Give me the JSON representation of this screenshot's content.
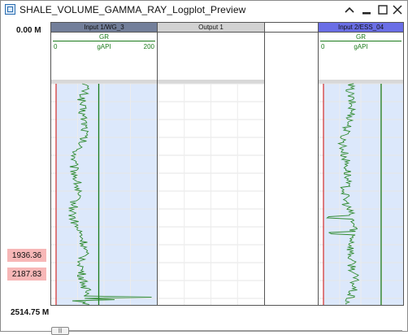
{
  "window": {
    "title": "SHALE_VOLUME_GAMMA_RAY_Logplot_Preview",
    "controls": {
      "collapse": "chevron-up-icon",
      "minimize": "minimize-icon",
      "maximize": "maximize-icon",
      "close": "close-icon"
    }
  },
  "depth": {
    "top": "0.00 M",
    "bottom": "2514.75 M",
    "markers": [
      {
        "label": "1936.36",
        "fraction": 0.77
      },
      {
        "label": "2187.83",
        "fraction": 0.87
      }
    ]
  },
  "tracks": [
    {
      "header": "Input 1/WG_3",
      "header_color": "#737f9a",
      "curve": {
        "name": "GR",
        "unit": "gAPI",
        "min": "0",
        "max": "200",
        "color": "#1a7a1a"
      },
      "plot": {
        "shaded": true
      }
    },
    {
      "header": "Output 1",
      "header_color": "#d2d2d2",
      "curve": null,
      "plot": {
        "shaded": false
      }
    },
    {
      "header": "",
      "header_color": "#ffffff",
      "curve": null,
      "plot": {
        "shaded": false
      }
    },
    {
      "header": "Input 2/ESS_04",
      "header_color": "#6a6ee6",
      "curve": {
        "name": "GR",
        "unit": "gAPI",
        "min": "0",
        "max": "",
        "color": "#1a7a1a"
      },
      "plot": {
        "shaded": true
      }
    }
  ],
  "colors": {
    "plot_shade": "#dce8fb",
    "left_bound_line": "#d43a3a",
    "cutoff_line": "#1a7a1a",
    "curve": "#2f8a2f"
  },
  "scrollbar": {
    "position": 0.0
  }
}
